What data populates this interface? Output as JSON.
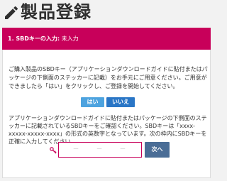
{
  "header": {
    "title": "製品登録",
    "icon": "pencil-icon"
  },
  "step": {
    "label": "1. SBDキーの入力:",
    "status": "未入力"
  },
  "intro": {
    "text": "ご購入製品のSBDキー（アプリケーションダウンロードガイドに貼付またはパッケージの下側面のステッカーに記載）をお手元にご用意ください。ご用意ができましたら「はい」をクリックし、ご登録を開始してください。",
    "yes_label": "はい",
    "no_label": "いいえ"
  },
  "key_entry": {
    "instructions": "アプリケーションダウンロードガイドに貼付またはパッケージの下側面のステッカーに記載されているSBDキーをご確認ください。SBDキーは「xxxx-xxxxx-xxxxx-xxxx」の形式の英数字となっています。次の枠内にSBDキーを正確に入力してください。",
    "input_placeholder": "－　　－　　－",
    "next_label": "次へ",
    "key_icon": "key-icon"
  },
  "colors": {
    "brand": "#c8005a",
    "yes_button": "#4da3df",
    "no_button": "#2a76c6",
    "next_button": "#4a6d96"
  }
}
